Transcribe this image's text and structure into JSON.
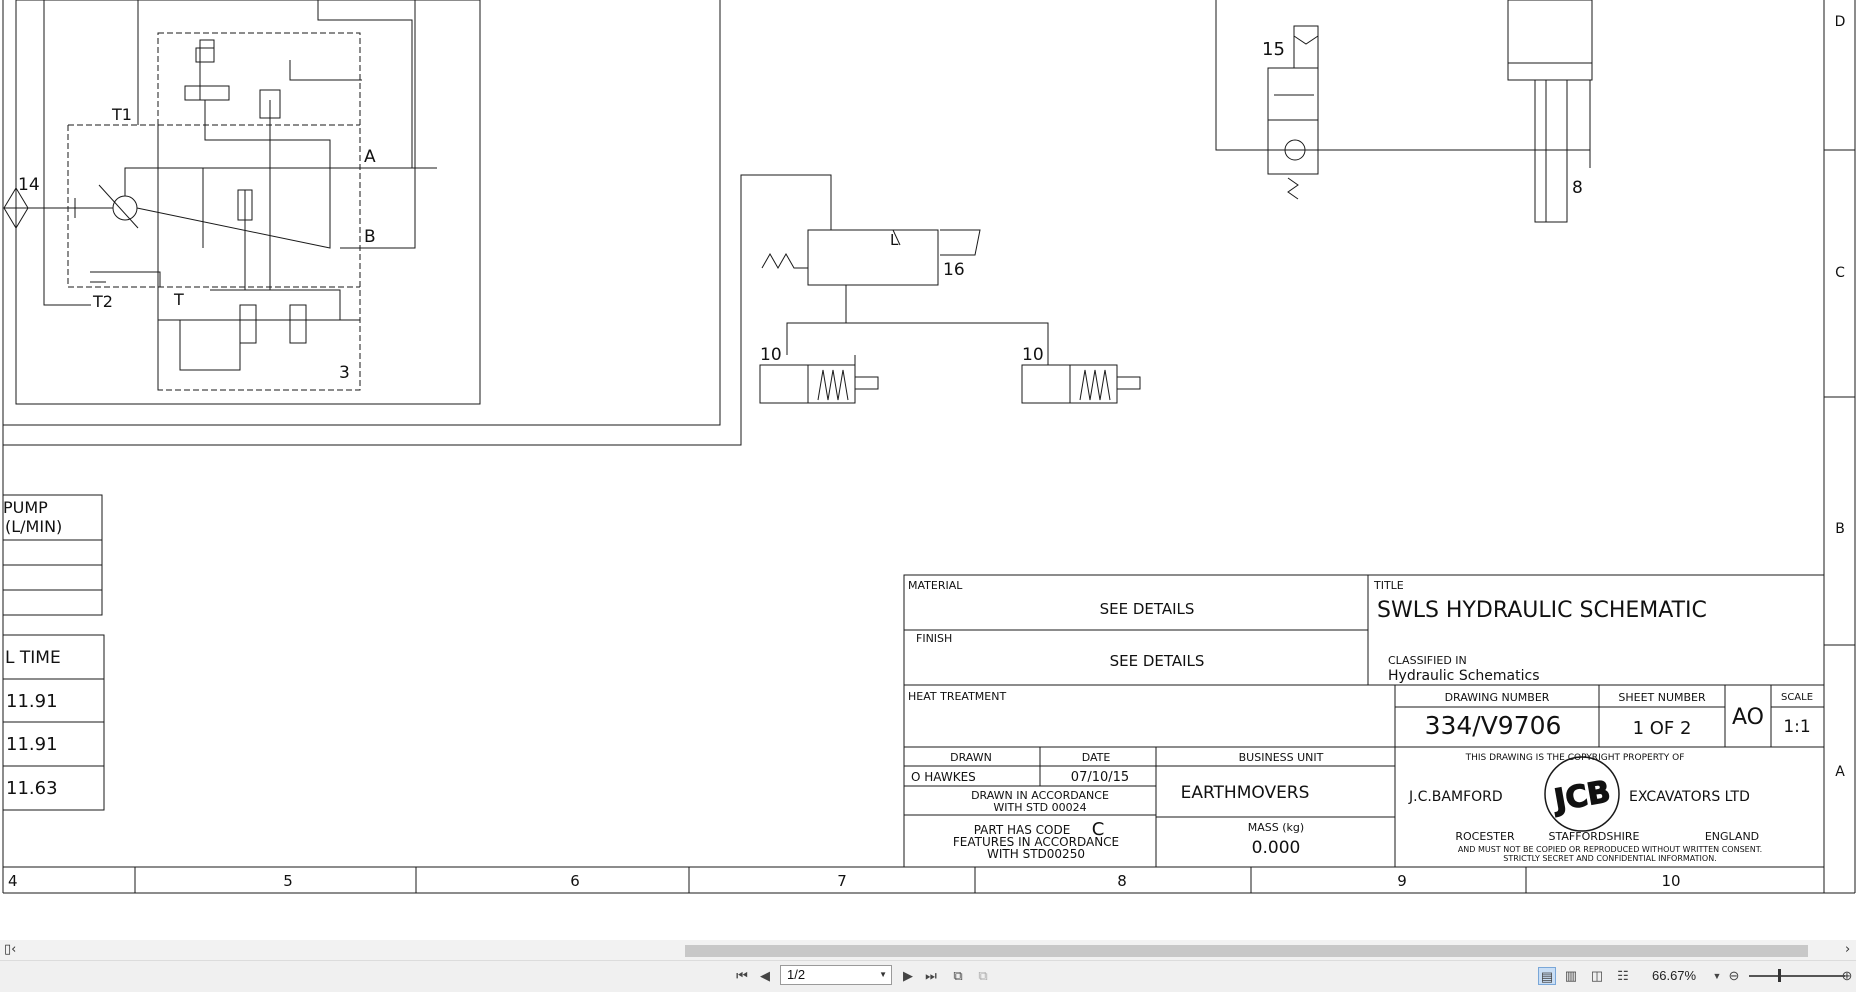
{
  "drawing": {
    "zone_letters": [
      "D",
      "C",
      "B",
      "A"
    ],
    "column_numbers": [
      "4",
      "5",
      "6",
      "7",
      "8",
      "9",
      "10"
    ],
    "component_labels": {
      "t1": "T1",
      "t2": "T2",
      "t": "T",
      "port_a": "A",
      "port_b": "B",
      "c14": "14",
      "c3": "3",
      "c15": "15",
      "c8": "8",
      "c16": "16",
      "c10a": "10",
      "c10b": "10",
      "l": "L"
    },
    "pump_table": {
      "header_line1": "PUMP",
      "header_line2": "(L/MIN)"
    },
    "time_table": {
      "header": "L TIME",
      "values": [
        "11.91",
        "11.91",
        "11.63"
      ]
    }
  },
  "title_block": {
    "material_label": "MATERIAL",
    "material_value": "SEE DETAILS",
    "finish_label": "FINISH",
    "finish_value": "SEE DETAILS",
    "title_label": "TITLE",
    "title_value": "SWLS HYDRAULIC SCHEMATIC",
    "classified_label": "CLASSIFIED IN",
    "classified_value": "Hydraulic Schematics",
    "heat_treatment_label": "HEAT TREATMENT",
    "drawing_number_label": "DRAWING NUMBER",
    "drawing_number_value": "334/V9706",
    "sheet_number_label": "SHEET NUMBER",
    "sheet_number_value": "1 OF 2",
    "sheet_size": "AO",
    "scale_label": "SCALE",
    "scale_value": "1:1",
    "drawn_label": "DRAWN",
    "date_label": "DATE",
    "drawn_value": "O HAWKES",
    "date_value": "07/10/15",
    "business_unit_label": "BUSINESS UNIT",
    "business_unit_value": "EARTHMOVERS",
    "std_line1": "DRAWN IN ACCORDANCE",
    "std_line2": "WITH STD 00024",
    "code_line1": "PART HAS CODE",
    "code_letter": "C",
    "code_line2": "FEATURES IN ACCORDANCE",
    "code_line3": "WITH STD00250",
    "mass_label": "MASS (kg)",
    "mass_value": "0.000",
    "copyright_line": "THIS DRAWING IS THE COPYRIGHT PROPERTY OF",
    "company_left": "J.C.BAMFORD",
    "company_right": "EXCAVATORS LTD",
    "logo_text": "JCB",
    "address_town": "ROCESTER",
    "address_county": "STAFFORDSHIRE",
    "address_country": "ENGLAND",
    "notice_line1": "AND MUST NOT BE COPIED OR REPRODUCED WITHOUT WRITTEN CONSENT.",
    "notice_line2": "STRICTLY SECRET AND CONFIDENTIAL INFORMATION."
  },
  "viewer": {
    "page_indicator": "1/2",
    "zoom_level": "66.67%",
    "icons": [
      "first-page-icon",
      "prev-page-icon",
      "next-page-icon",
      "last-page-icon",
      "single-page-view-icon",
      "continuous-view-icon",
      "facing-view-icon",
      "continuous-facing-view-icon",
      "zoom-out-icon",
      "zoom-in-icon"
    ]
  }
}
